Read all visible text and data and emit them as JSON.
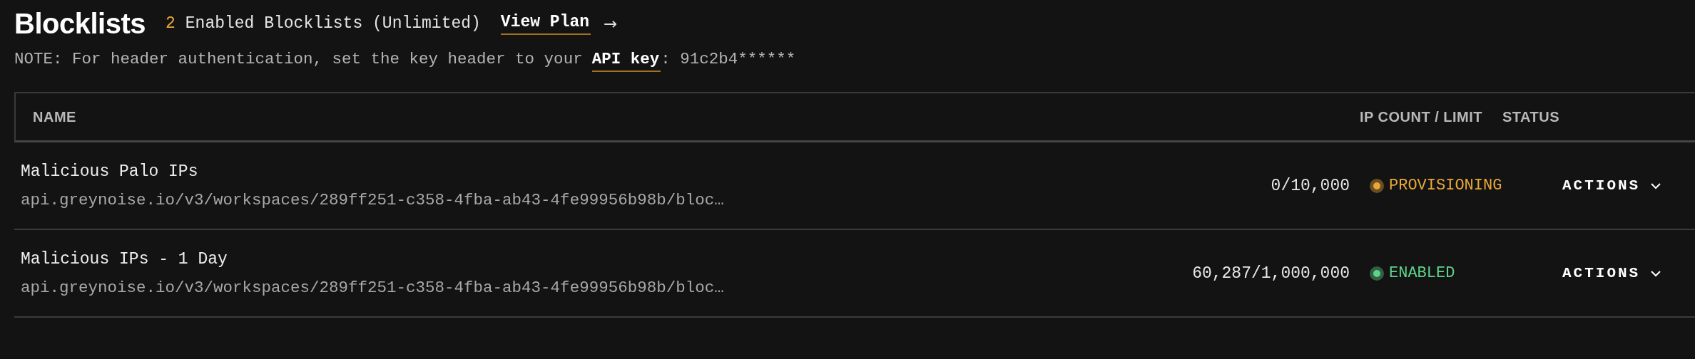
{
  "header": {
    "title": "Blocklists",
    "count": "2",
    "summary": "Enabled Blocklists (Unlimited)",
    "plan_link": "View Plan",
    "plan_arrow": "→"
  },
  "note": {
    "text": "NOTE: For header authentication, set the key header to your",
    "link": "API key",
    "suffix": ": 91c2b4******"
  },
  "table": {
    "columns": [
      "NAME",
      "IP COUNT / LIMIT",
      "STATUS"
    ],
    "rows": [
      {
        "name": "Malicious Palo IPs",
        "url": "api.greynoise.io/v3/workspaces/289ff251-c358-4fba-ab43-4fe99956b98b/bloc…",
        "ip_count": "0/10,000",
        "status": "PROVISIONING",
        "color": "#e8a838",
        "actions": "ACTIONS"
      },
      {
        "name": "Malicious IPs - 1 Day",
        "url": "api.greynoise.io/v3/workspaces/289ff251-c358-4fba-ab43-4fe99956b98b/bloc…",
        "ip_count": "60,287/1,000,000",
        "status": "ENABLED",
        "color": "#5fd38a",
        "actions": "ACTIONS"
      }
    ]
  }
}
